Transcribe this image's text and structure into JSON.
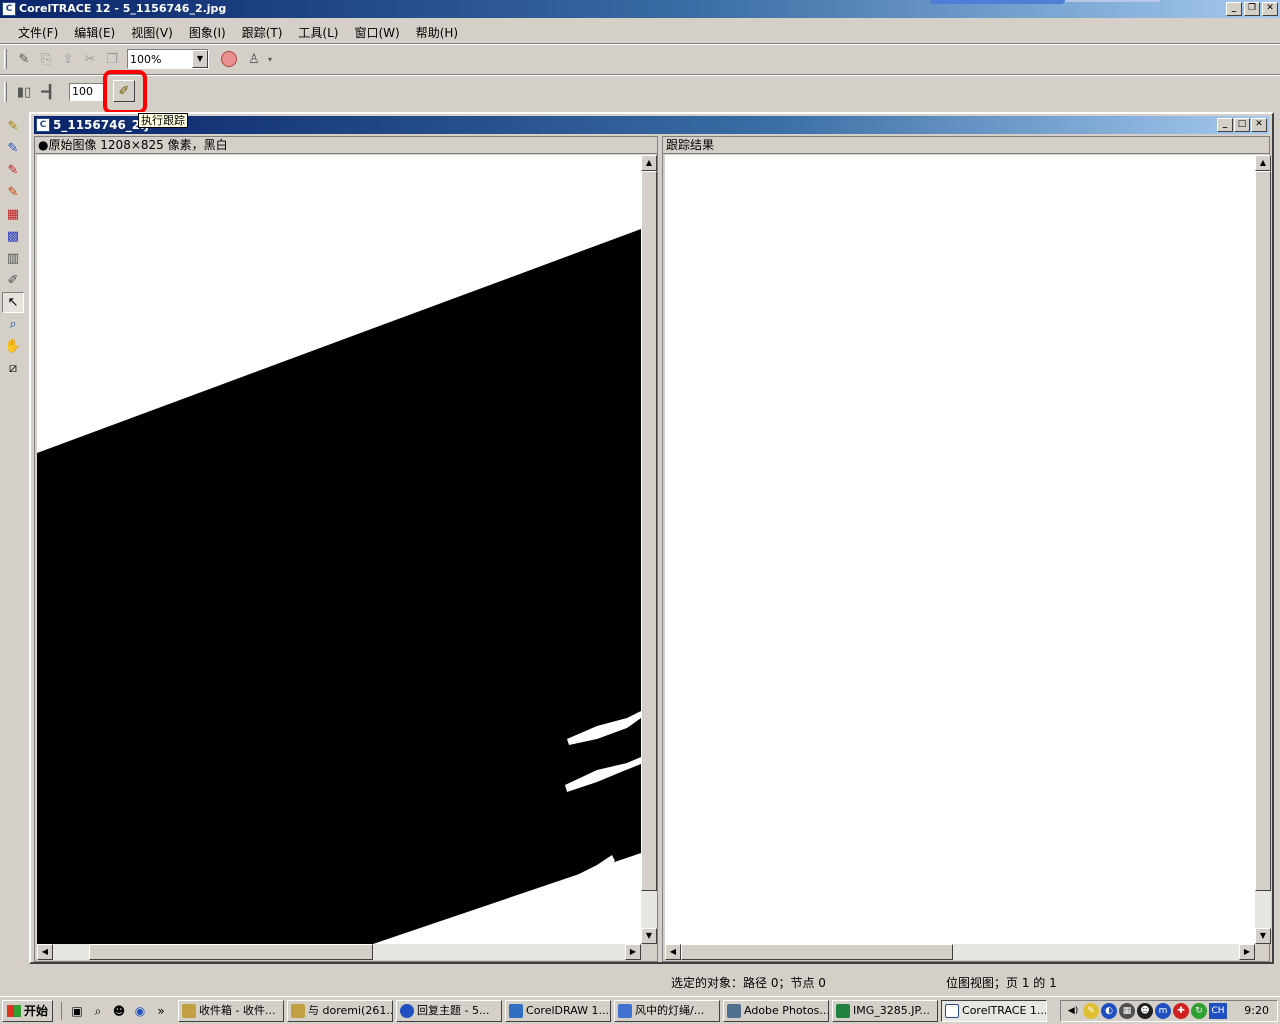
{
  "window": {
    "title": "CorelTRACE 12 - 5_1156746_2.jpg",
    "minimize": "_",
    "restore": "❐",
    "close": "✕"
  },
  "menu": [
    "文件(F)",
    "编辑(E)",
    "视图(V)",
    "图象(I)",
    "跟踪(T)",
    "工具(L)",
    "窗口(W)",
    "帮助(H)"
  ],
  "toolbar": {
    "zoom_value": "100%",
    "smooth_value": "100",
    "trace_tooltip": "执行跟踪"
  },
  "document": {
    "title": "5_1156746_2.j",
    "left_pane_header": "●原始图像  1208×825 像素，黑白",
    "right_pane_header": "跟踪结果"
  },
  "statusbar": {
    "selection": "选定的对象：路径 0；节点 0",
    "view": "位图视图；页 1 的 1"
  },
  "taskbar": {
    "start": "开始",
    "tasks": [
      "收件箱 - 收件...",
      "与 doremi(261...",
      "回复主题 - 5...",
      "CorelDRAW 1...",
      "风中的灯绳/...",
      "Adobe Photos...",
      "IMG_3285.JP...",
      "CorelTRACE 1..."
    ],
    "lang": "CH",
    "clock": "9:20"
  },
  "colors": {
    "title_active": "#0a246a",
    "highlight_red": "#ff0000",
    "face": "#d4d0c8"
  }
}
